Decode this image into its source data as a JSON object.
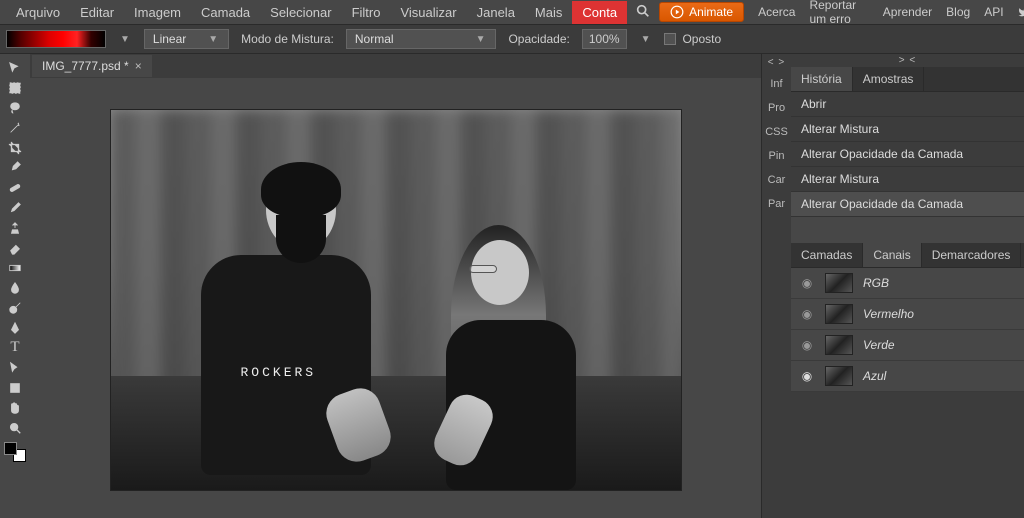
{
  "menu": {
    "items": [
      "Arquivo",
      "Editar",
      "Imagem",
      "Camada",
      "Selecionar",
      "Filtro",
      "Visualizar",
      "Janela",
      "Mais",
      "Conta"
    ],
    "animate": "Animate",
    "links": [
      "Acerca",
      "Reportar um erro",
      "Aprender",
      "Blog",
      "API"
    ]
  },
  "options": {
    "gradientType": "Linear",
    "blendLabel": "Modo de Mistura:",
    "blendMode": "Normal",
    "opacityLabel": "Opacidade:",
    "opacityValue": "100%",
    "reverseLabel": "Oposto"
  },
  "document": {
    "tab": "IMG_7777.psd *",
    "shirtText": "ROCKERS"
  },
  "miniSidebar": [
    "Inf",
    "Pro",
    "CSS",
    "Pin",
    "Car",
    "Par"
  ],
  "historyPanel": {
    "tabs": [
      "História",
      "Amostras"
    ],
    "items": [
      "Abrir",
      "Alterar Mistura",
      "Alterar Opacidade da Camada",
      "Alterar Mistura",
      "Alterar Opacidade da Camada"
    ]
  },
  "layersPanel": {
    "tabs": [
      "Camadas",
      "Canais",
      "Demarcadores"
    ],
    "channels": [
      {
        "name": "RGB",
        "visible": false
      },
      {
        "name": "Vermelho",
        "visible": false
      },
      {
        "name": "Verde",
        "visible": false
      },
      {
        "name": "Azul",
        "visible": true
      }
    ]
  }
}
